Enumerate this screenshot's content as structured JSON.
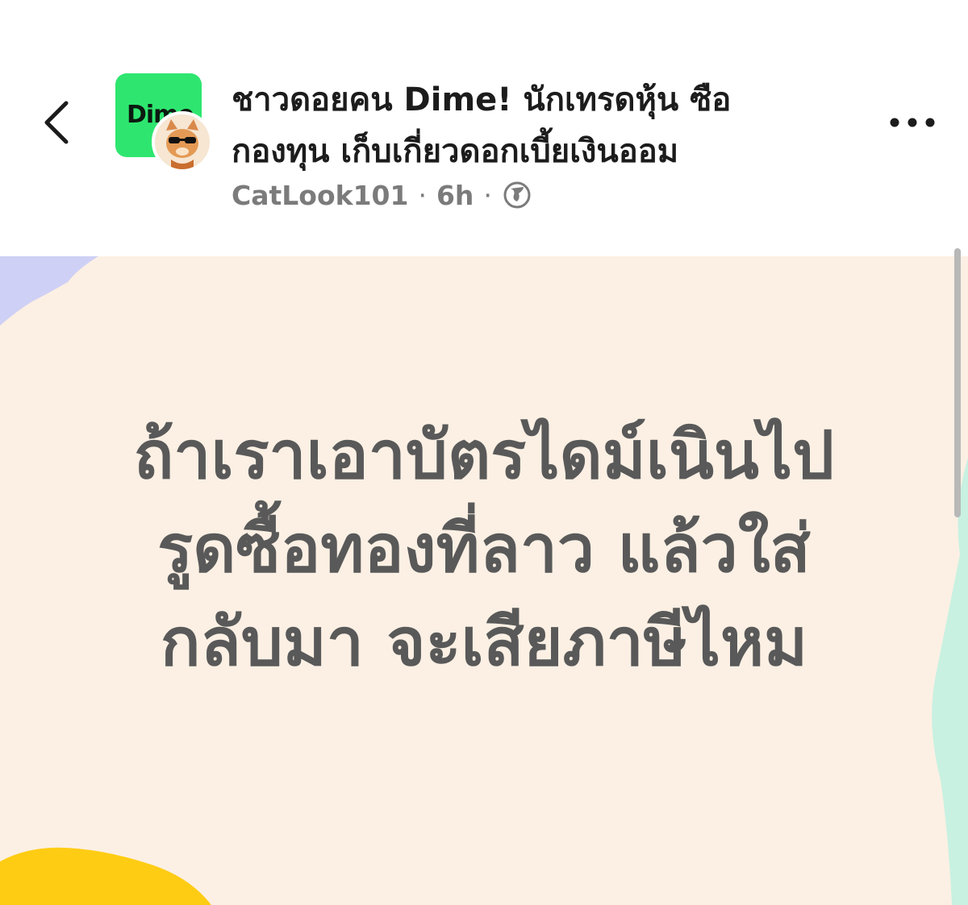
{
  "header": {
    "back_icon": "chevron-left-icon",
    "group_avatar_text": "Dime",
    "group_avatar_color": "#2ee66f",
    "title": "ชาวดอยคน Dime! นักเทรดหุ้น ซือ\nกองทุน เก็บเกี่ยวดอกเบี้ยเงินออม",
    "author": "CatLook101",
    "separator": "·",
    "time": "6h",
    "privacy_icon": "globe-icon",
    "more_icon": "more-dots-icon"
  },
  "post": {
    "text": "ถ้าเราเอาบัตรไดม์เนินไป\nรูดซื้อทองที่ลาว แล้วใส่\nกลับมา จะเสียภาษีไหม",
    "background_color": "#fcf0e4",
    "text_color": "#595959"
  }
}
